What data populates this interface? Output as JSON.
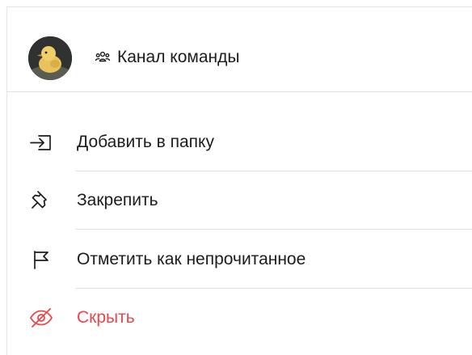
{
  "header": {
    "channel_name": "Канал команды",
    "avatar_icon": "duckling-photo",
    "channel_icon": "group-icon"
  },
  "menu": [
    {
      "label": "Добавить в папку",
      "icon": "add-to-folder-icon",
      "color": "#1c1c1e"
    },
    {
      "label": "Закрепить",
      "icon": "pin-icon",
      "color": "#1c1c1e"
    },
    {
      "label": "Отметить как непрочитанное",
      "icon": "flag-icon",
      "color": "#1c1c1e"
    },
    {
      "label": "Скрыть",
      "icon": "eye-off-icon",
      "color": "#e5484d"
    }
  ],
  "colors": {
    "text": "#1c1c1e",
    "danger": "#e5484d",
    "separator": "#e0e0e3"
  }
}
